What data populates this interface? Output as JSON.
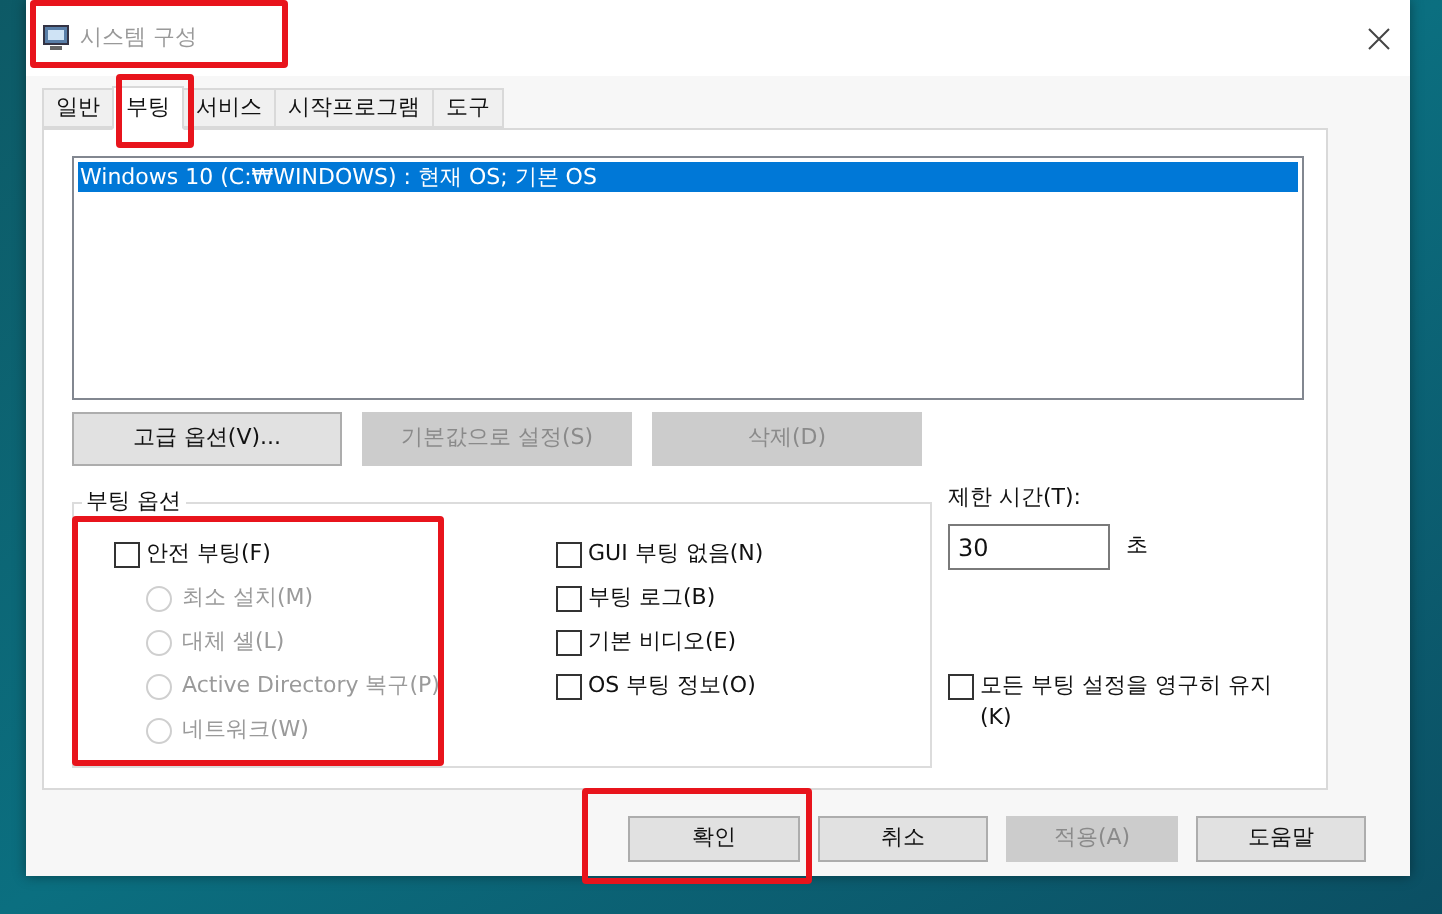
{
  "window": {
    "title": "시스템 구성",
    "highlighted": true
  },
  "tabs": [
    {
      "label": "일반",
      "selected": false,
      "highlighted": false
    },
    {
      "label": "부팅",
      "selected": true,
      "highlighted": true
    },
    {
      "label": "서비스",
      "selected": false,
      "highlighted": false
    },
    {
      "label": "시작프로그램",
      "selected": false,
      "highlighted": false
    },
    {
      "label": "도구",
      "selected": false,
      "highlighted": false
    }
  ],
  "boot_list": [
    {
      "label": "Windows 10 (C:₩WINDOWS) : 현재 OS; 기본 OS",
      "selected": true
    }
  ],
  "list_buttons": [
    {
      "label": "고급 옵션(V)...",
      "disabled": false
    },
    {
      "label": "기본값으로 설정(S)",
      "disabled": true
    },
    {
      "label": "삭제(D)",
      "disabled": true
    }
  ],
  "boot_options": {
    "legend": "부팅 옵션",
    "highlighted": true,
    "safe_boot": {
      "label": "안전 부팅(F)",
      "checked": false
    },
    "modes": [
      {
        "label": "최소 설치(M)",
        "selected": false,
        "disabled": true
      },
      {
        "label": "대체 셸(L)",
        "selected": false,
        "disabled": true
      },
      {
        "label": "Active Directory 복구(P)",
        "selected": false,
        "disabled": true
      },
      {
        "label": "네트워크(W)",
        "selected": false,
        "disabled": true
      }
    ],
    "flags": [
      {
        "label": "GUI 부팅 없음(N)",
        "checked": false
      },
      {
        "label": "부팅 로그(B)",
        "checked": false
      },
      {
        "label": "기본 비디오(E)",
        "checked": false
      },
      {
        "label": "OS 부팅 정보(O)",
        "checked": false
      }
    ]
  },
  "timeout": {
    "label": "제한 시간(T):",
    "value": "30",
    "unit": "초"
  },
  "persist": {
    "label": "모든 부팅 설정을 영구히 유지(K)",
    "checked": false
  },
  "buttons": [
    {
      "label": "확인",
      "disabled": false,
      "highlighted": true
    },
    {
      "label": "취소",
      "disabled": false,
      "highlighted": false
    },
    {
      "label": "적용(A)",
      "disabled": true,
      "highlighted": false
    },
    {
      "label": "도움말",
      "disabled": false,
      "highlighted": false
    }
  ]
}
